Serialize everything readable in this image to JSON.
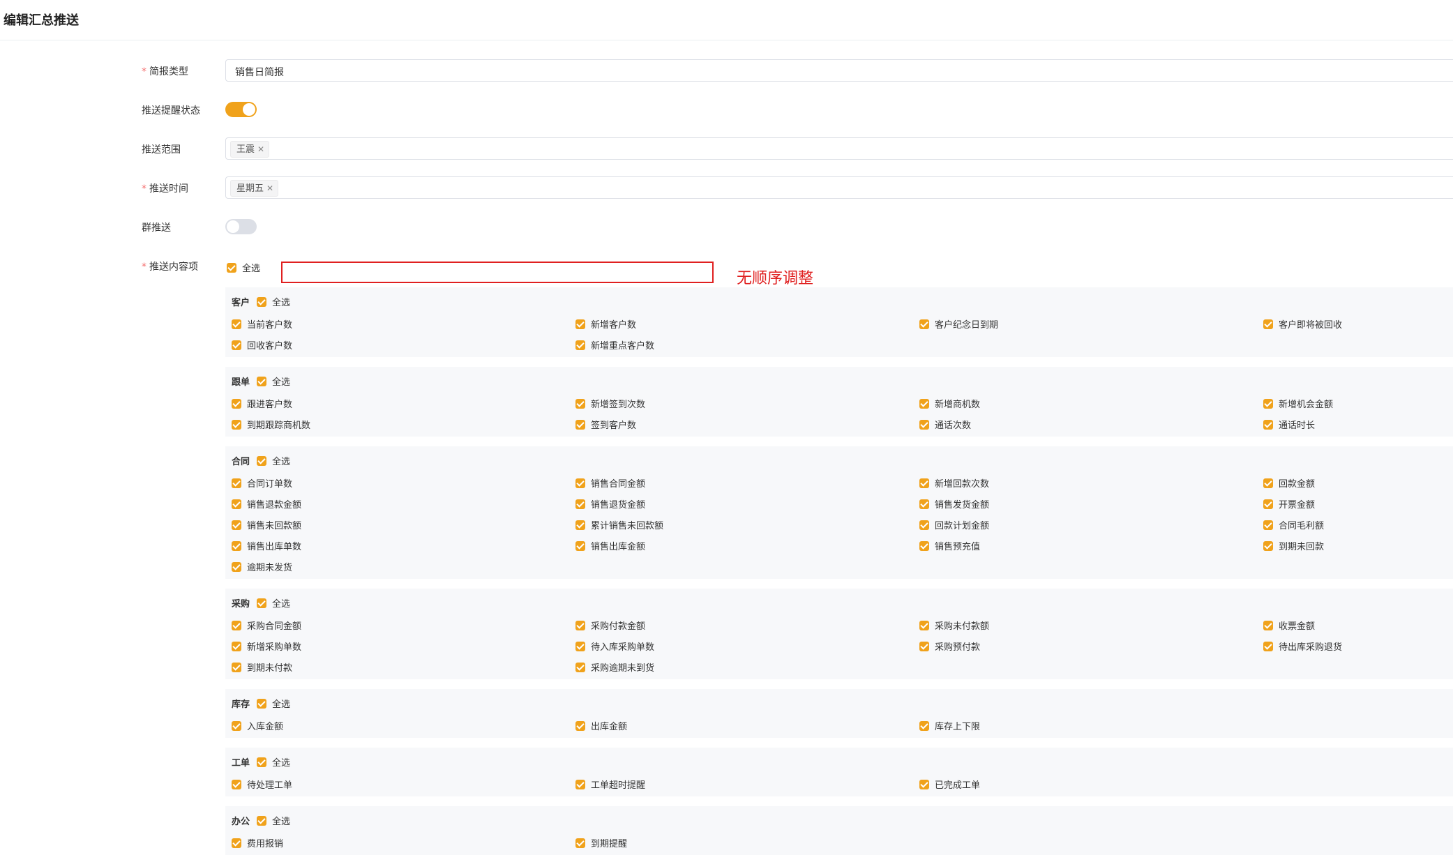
{
  "page": {
    "title": "编辑汇总推送"
  },
  "form": {
    "report_type": {
      "label": "简报类型",
      "required": true,
      "value": "销售日简报"
    },
    "push_reminder": {
      "label": "推送提醒状态",
      "on": true
    },
    "push_scope": {
      "label": "推送范围",
      "tags": [
        "王震"
      ]
    },
    "push_time": {
      "label": "推送时间",
      "required": true,
      "tags": [
        "星期五"
      ]
    },
    "group_push": {
      "label": "群推送",
      "on": false
    },
    "content": {
      "label": "推送内容项",
      "required": true,
      "select_all": "全选"
    }
  },
  "annotation": {
    "text": "无顺序调整",
    "color": "#e02020"
  },
  "groups": [
    {
      "title": "客户",
      "select_all": "全选",
      "items": [
        "当前客户数",
        "新增客户数",
        "客户纪念日到期",
        "客户即将被回收",
        "回收客户数",
        "新增重点客户数"
      ]
    },
    {
      "title": "跟单",
      "select_all": "全选",
      "items": [
        "跟进客户数",
        "新增签到次数",
        "新增商机数",
        "新增机会金额",
        "到期跟踪商机数",
        "签到客户数",
        "通话次数",
        "通话时长"
      ]
    },
    {
      "title": "合同",
      "select_all": "全选",
      "items": [
        "合同订单数",
        "销售合同金额",
        "新增回款次数",
        "回款金额",
        "销售退款金额",
        "销售退货金额",
        "销售发货金额",
        "开票金额",
        "销售未回款额",
        "累计销售未回款额",
        "回款计划金额",
        "合同毛利额",
        "销售出库单数",
        "销售出库金额",
        "销售预充值",
        "到期未回款",
        "逾期未发货"
      ]
    },
    {
      "title": "采购",
      "select_all": "全选",
      "items": [
        "采购合同金额",
        "采购付款金额",
        "采购未付款额",
        "收票金额",
        "新增采购单数",
        "待入库采购单数",
        "采购预付款",
        "待出库采购退货",
        "到期未付款",
        "采购逾期未到货"
      ]
    },
    {
      "title": "库存",
      "select_all": "全选",
      "items": [
        "入库金额",
        "出库金额",
        "库存上下限"
      ]
    },
    {
      "title": "工单",
      "select_all": "全选",
      "items": [
        "待处理工单",
        "工单超时提醒",
        "已完成工单"
      ]
    },
    {
      "title": "办公",
      "select_all": "全选",
      "items": [
        "费用报销",
        "到期提醒"
      ]
    }
  ],
  "colors": {
    "accent": "#f0a21b",
    "required": "#f56c6c",
    "group_bg": "#f7f8fa"
  }
}
